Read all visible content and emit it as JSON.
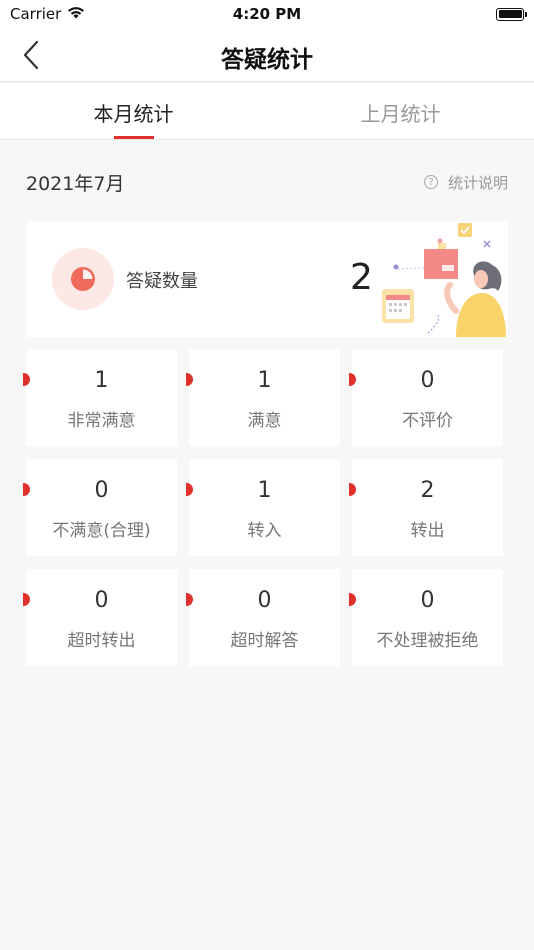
{
  "status_bar": {
    "carrier": "Carrier",
    "time": "4:20 PM"
  },
  "nav": {
    "title": "答疑统计"
  },
  "tabs": [
    {
      "label": "本月统计",
      "active": true
    },
    {
      "label": "上月统计",
      "active": false
    }
  ],
  "period": {
    "date": "2021年7月",
    "help_label": "统计说明",
    "help_icon_glyph": "?"
  },
  "summary": {
    "label": "答疑数量",
    "count": "2",
    "icon": "pie-chart-icon"
  },
  "stats": [
    {
      "value": "1",
      "label": "非常满意"
    },
    {
      "value": "1",
      "label": "满意"
    },
    {
      "value": "0",
      "label": "不评价"
    },
    {
      "value": "0",
      "label": "不满意(合理)"
    },
    {
      "value": "1",
      "label": "转入"
    },
    {
      "value": "2",
      "label": "转出"
    },
    {
      "value": "0",
      "label": "超时转出"
    },
    {
      "value": "0",
      "label": "超时解答"
    },
    {
      "value": "0",
      "label": "不处理被拒绝"
    }
  ],
  "colors": {
    "accent": "#e0302b",
    "icon_bg": "#fde8e6",
    "pie": "#f06a5c",
    "background": "#f7f7f7"
  }
}
